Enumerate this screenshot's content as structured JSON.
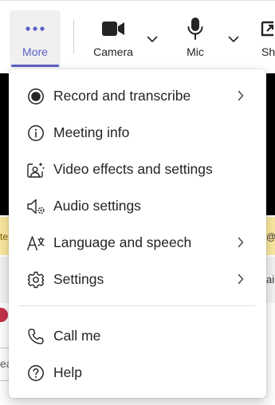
{
  "toolbar": {
    "more_label": "More",
    "camera_label": "Camera",
    "mic_label": "Mic",
    "share_label_partial": "Sh"
  },
  "background": {
    "yellow_left_text": "te",
    "yellow_right_text": "@",
    "gray_right_text": "ai",
    "input_partial_text": "ea"
  },
  "menu": {
    "items": [
      {
        "label": "Record and transcribe",
        "icon": "record-icon",
        "has_submenu": true
      },
      {
        "label": "Meeting info",
        "icon": "info-icon",
        "has_submenu": false
      },
      {
        "label": "Video effects and settings",
        "icon": "video-effects-icon",
        "has_submenu": false
      },
      {
        "label": "Audio settings",
        "icon": "speaker-settings-icon",
        "has_submenu": false
      },
      {
        "label": "Language and speech",
        "icon": "language-icon",
        "has_submenu": true
      },
      {
        "label": "Settings",
        "icon": "gear-icon",
        "has_submenu": true
      },
      {
        "label": "Call me",
        "icon": "phone-icon",
        "has_submenu": false
      },
      {
        "label": "Help",
        "icon": "help-icon",
        "has_submenu": false
      }
    ]
  },
  "colors": {
    "accent": "#5b5fc7",
    "text": "#242424",
    "menu_bg": "#ffffff",
    "banner": "#fbe9a0"
  }
}
